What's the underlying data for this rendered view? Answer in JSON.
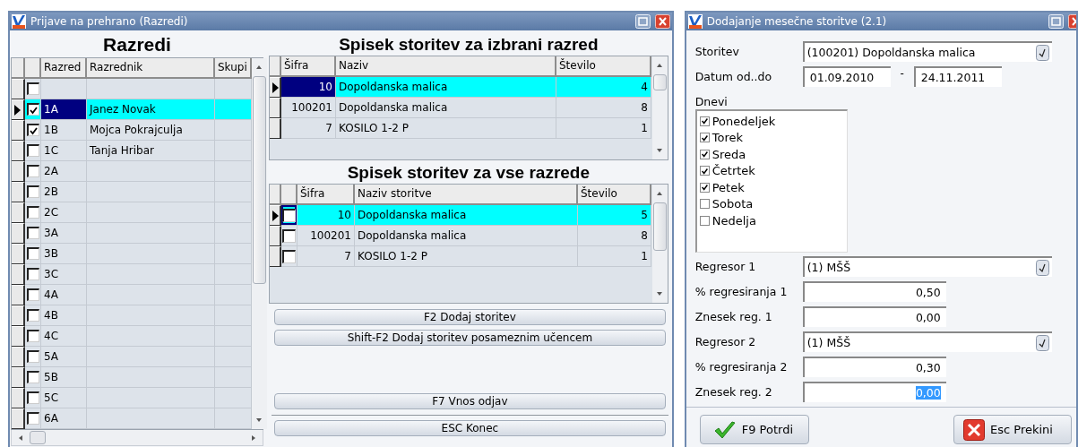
{
  "main_window": {
    "title": "Prijave na prehrano (Razredi)",
    "classes": {
      "title": "Razredi",
      "columns": [
        "Razred",
        "Razrednik",
        "Skupi"
      ],
      "rows": [
        {
          "checked": false,
          "selected": false
        },
        {
          "class": "1A",
          "teacher": "Janez Novak",
          "checked": true,
          "selected": true
        },
        {
          "class": "1B",
          "teacher": "Mojca Pokrajculja",
          "checked": true,
          "selected": false
        },
        {
          "class": "1C",
          "teacher": "Tanja Hribar",
          "checked": false,
          "selected": false
        },
        {
          "class": "2A",
          "checked": false,
          "selected": false
        },
        {
          "class": "2B",
          "checked": false,
          "selected": false
        },
        {
          "class": "2C",
          "checked": false,
          "selected": false
        },
        {
          "class": "3A",
          "checked": false,
          "selected": false
        },
        {
          "class": "3B",
          "checked": false,
          "selected": false
        },
        {
          "class": "3C",
          "checked": false,
          "selected": false
        },
        {
          "class": "4A",
          "checked": false,
          "selected": false
        },
        {
          "class": "4B",
          "checked": false,
          "selected": false
        },
        {
          "class": "4C",
          "checked": false,
          "selected": false
        },
        {
          "class": "5A",
          "checked": false,
          "selected": false
        },
        {
          "class": "5B",
          "checked": false,
          "selected": false
        },
        {
          "class": "5C",
          "checked": false,
          "selected": false
        },
        {
          "class": "6A",
          "checked": false,
          "selected": false
        }
      ]
    },
    "class_services": {
      "title": "Spisek storitev za izbrani razred",
      "columns": [
        "Šifra",
        "Naziv",
        "Število"
      ],
      "rows": [
        {
          "code": "10",
          "name": "Dopoldanska malica",
          "count": "4",
          "selected": true
        },
        {
          "code": "100201",
          "name": "Dopoldanska malica",
          "count": "8",
          "selected": false
        },
        {
          "code": "7",
          "name": "KOSILO 1-2 P",
          "count": "1",
          "selected": false
        }
      ]
    },
    "all_services": {
      "title": "Spisek storitev za vse razrede",
      "columns": [
        "Šifra",
        "Naziv storitve",
        "Število"
      ],
      "rows": [
        {
          "code": "10",
          "name": "Dopoldanska malica",
          "count": "5",
          "checked": false,
          "selected": true
        },
        {
          "code": "100201",
          "name": "Dopoldanska malica",
          "count": "8",
          "checked": false,
          "selected": false
        },
        {
          "code": "7",
          "name": "KOSILO 1-2 P",
          "count": "1",
          "checked": false,
          "selected": false
        }
      ]
    },
    "buttons": [
      {
        "label": "F2 Dodaj storitev",
        "kind": "top"
      },
      {
        "label": "Shift-F2 Dodaj storitev posameznim učencem",
        "kind": "top"
      },
      {
        "label": "F7 Vnos odjav",
        "kind": "middle"
      },
      {
        "label": "ESC Konec",
        "kind": "bottom"
      }
    ]
  },
  "dialog": {
    "title": "Dodajanje mesečne storitve  (2.1)",
    "fields": [
      {
        "kind": "combo",
        "label": "Storitev",
        "value": "(100201) Dopoldanska malica"
      },
      {
        "kind": "date_range",
        "label": "Datum od..do",
        "from": "01.09.2010",
        "separator": "-",
        "to": "24.11.2011"
      },
      {
        "kind": "days",
        "label": "Dnevi",
        "items": [
          {
            "label": "Ponedeljek",
            "checked": true
          },
          {
            "label": "Torek",
            "checked": true
          },
          {
            "label": "Sreda",
            "checked": true
          },
          {
            "label": "Četrtek",
            "checked": true
          },
          {
            "label": "Petek",
            "checked": true
          },
          {
            "label": "Sobota",
            "checked": false
          },
          {
            "label": "Nedelja",
            "checked": false
          }
        ]
      },
      {
        "kind": "combo",
        "label": "Regresor 1",
        "value": "(1) MŠŠ"
      },
      {
        "kind": "number",
        "label": "% regresiranja 1",
        "value": "0,50",
        "highlighted": false
      },
      {
        "kind": "number",
        "label": "Znesek reg. 1",
        "value": "0,00",
        "highlighted": false
      },
      {
        "kind": "combo",
        "label": "Regresor 2",
        "value": "(1) MŠŠ"
      },
      {
        "kind": "number",
        "label": "% regresiranja 2",
        "value": "0,30",
        "highlighted": false
      },
      {
        "kind": "number",
        "label": "Znesek reg. 2",
        "value": "0,00",
        "highlighted": true
      }
    ],
    "buttons": [
      {
        "kind": "confirm",
        "label": "F9 Potrdi"
      },
      {
        "kind": "cancel",
        "label": "Esc Prekini"
      }
    ]
  }
}
